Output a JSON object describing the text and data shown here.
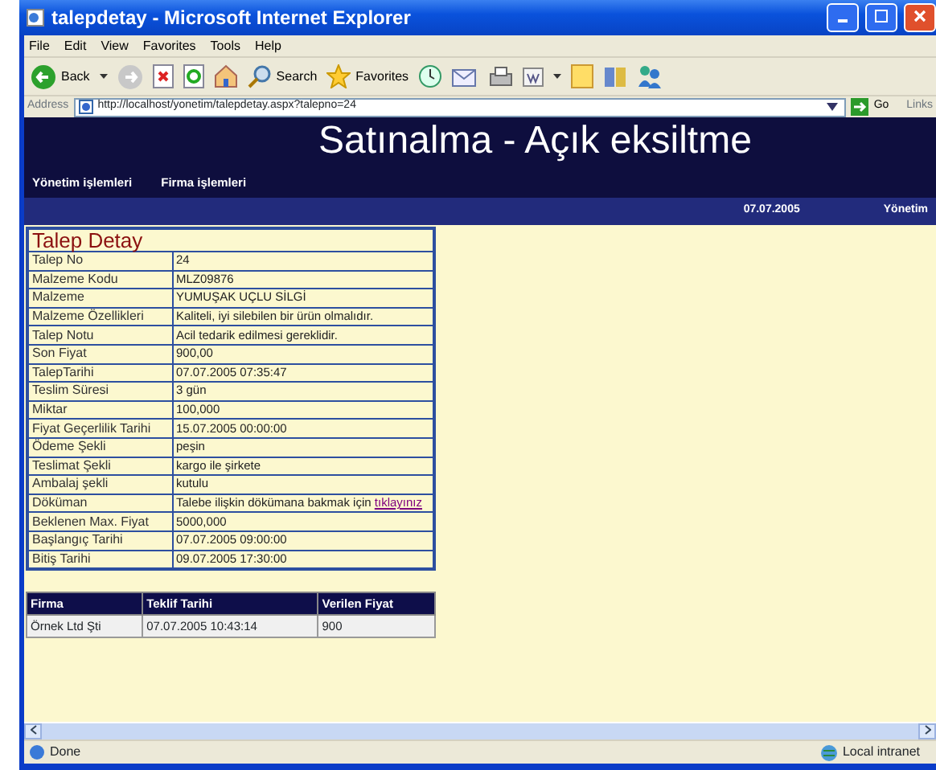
{
  "window": {
    "title": "talepdetay - Microsoft Internet Explorer"
  },
  "menu": [
    "File",
    "Edit",
    "View",
    "Favorites",
    "Tools",
    "Help"
  ],
  "toolbar": {
    "back": "Back",
    "search": "Search",
    "favorites": "Favorites"
  },
  "address": {
    "label": "Address",
    "url": "http://localhost/yonetim/talepdetay.aspx?talepno=24",
    "go": "Go",
    "links": "Links"
  },
  "page": {
    "title": "Satınalma - Açık eksiltme",
    "nav": [
      "Yönetim işlemleri",
      "Firma işlemleri"
    ],
    "date": "07.07.2005",
    "user": "Yönetim"
  },
  "detail": {
    "title": "Talep Detay",
    "rows": [
      {
        "label": "Talep No",
        "value": "24"
      },
      {
        "label": "Malzeme Kodu",
        "value": "MLZ09876"
      },
      {
        "label": "Malzeme",
        "value": "YUMUŞAK UÇLU SİLGİ"
      },
      {
        "label": "Malzeme Özellikleri",
        "value": "Kaliteli, iyi silebilen bir ürün olmalıdır."
      },
      {
        "label": "Talep Notu",
        "value": "Acil tedarik edilmesi gereklidir."
      },
      {
        "label": "Son Fiyat",
        "value": "900,00"
      },
      {
        "label": "TalepTarihi",
        "value": "07.07.2005 07:35:47"
      },
      {
        "label": "Teslim Süresi",
        "value": "3 gün"
      },
      {
        "label": "Miktar",
        "value": "100,000"
      },
      {
        "label": "Fiyat Geçerlilik Tarihi",
        "value": "15.07.2005 00:00:00"
      },
      {
        "label": "Ödeme Şekli",
        "value": "peşin"
      },
      {
        "label": "Teslimat Şekli",
        "value": "kargo ile şirkete"
      },
      {
        "label": "Ambalaj şekli",
        "value": "kutulu"
      },
      {
        "label": "Döküman",
        "value": "Talebe ilişkin dökümana bakmak için",
        "link": "tıklayınız"
      },
      {
        "label": "Beklenen Max. Fiyat",
        "value": "5000,000"
      },
      {
        "label": "Başlangıç Tarihi",
        "value": "07.07.2005 09:00:00"
      },
      {
        "label": "Bitiş Tarihi",
        "value": "09.07.2005 17:30:00"
      }
    ]
  },
  "bids": {
    "columns": [
      "Firma",
      "Teklif Tarihi",
      "Verilen Fiyat"
    ],
    "rows": [
      [
        "Örnek Ltd Şti",
        "07.07.2005 10:43:14",
        "900"
      ]
    ]
  },
  "status_bar": {
    "text": "Done",
    "zone": "Local intranet"
  }
}
